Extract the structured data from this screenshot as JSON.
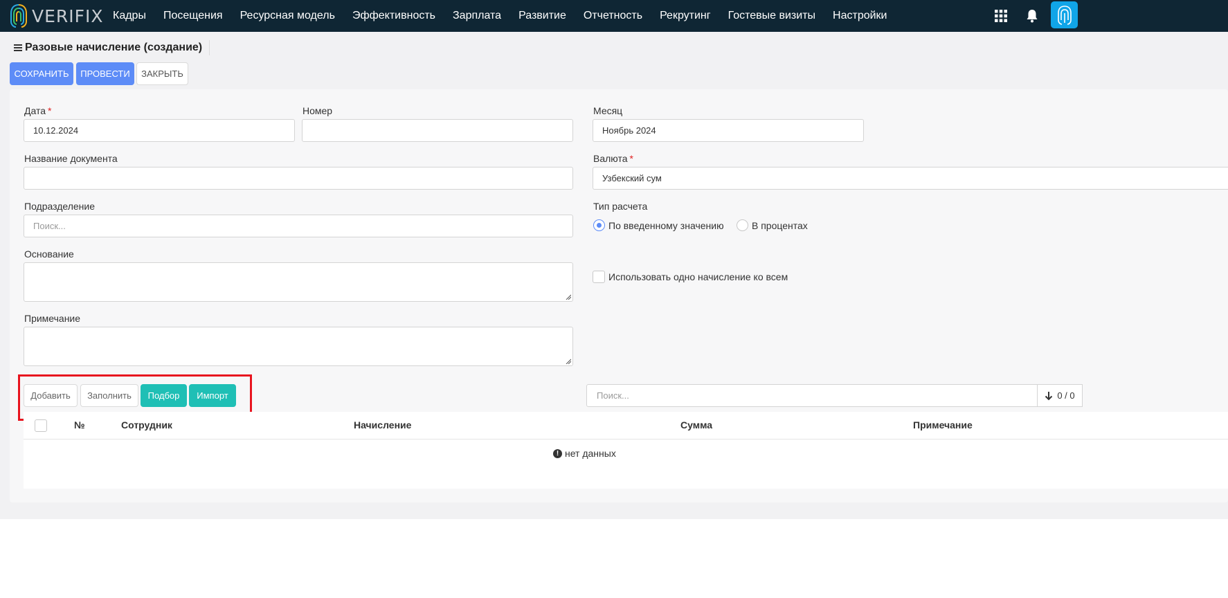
{
  "app": {
    "logo_text": "VERIFIX",
    "nav": [
      "Кадры",
      "Посещения",
      "Ресурсная модель",
      "Эффективность",
      "Зарплата",
      "Развитие",
      "Отчетность",
      "Рекрутинг",
      "Гостевые визиты",
      "Настройки"
    ],
    "icons": [
      "apps-grid-icon",
      "bell-icon",
      "fingerprint-avatar-icon"
    ]
  },
  "page": {
    "title": "Разовые начисление (создание)",
    "buttons": {
      "save": "Сохранить",
      "post": "Провести",
      "close": "Закрыть"
    }
  },
  "form": {
    "date": {
      "label": "Дата",
      "required_mark": "*",
      "value": "10.12.2024"
    },
    "number": {
      "label": "Номер",
      "value": ""
    },
    "month": {
      "label": "Месяц",
      "value": "Ноябрь 2024"
    },
    "doc_name": {
      "label": "Название документа",
      "value": ""
    },
    "currency": {
      "label": "Валюта",
      "required_mark": "*",
      "value": "Узбекский сум"
    },
    "division": {
      "label": "Подразделение",
      "placeholder": "Поиск..."
    },
    "calc_type": {
      "label": "Тип расчета",
      "options": [
        "По введенному значению",
        "В процентах"
      ],
      "selected": "По введенному значению"
    },
    "basis": {
      "label": "Основание",
      "value": ""
    },
    "single_accrual": {
      "label": "Использовать одно начисление ко всем",
      "checked": false
    },
    "note": {
      "label": "Примечание",
      "value": ""
    }
  },
  "grid": {
    "buttons": {
      "add": "Добавить",
      "fill": "Заполнить",
      "pick": "Подбор",
      "import": "Импорт"
    },
    "search_placeholder": "Поиск...",
    "count": "0 / 0",
    "columns": [
      "№",
      "Сотрудник",
      "Начисление",
      "Сумма",
      "Примечание"
    ],
    "empty_text": "нет данных",
    "rows": []
  },
  "colors": {
    "nav_bg": "#0f2634",
    "primary": "#5d8cf7",
    "teal": "#1fbfb5",
    "highlight": "#e8141f"
  }
}
